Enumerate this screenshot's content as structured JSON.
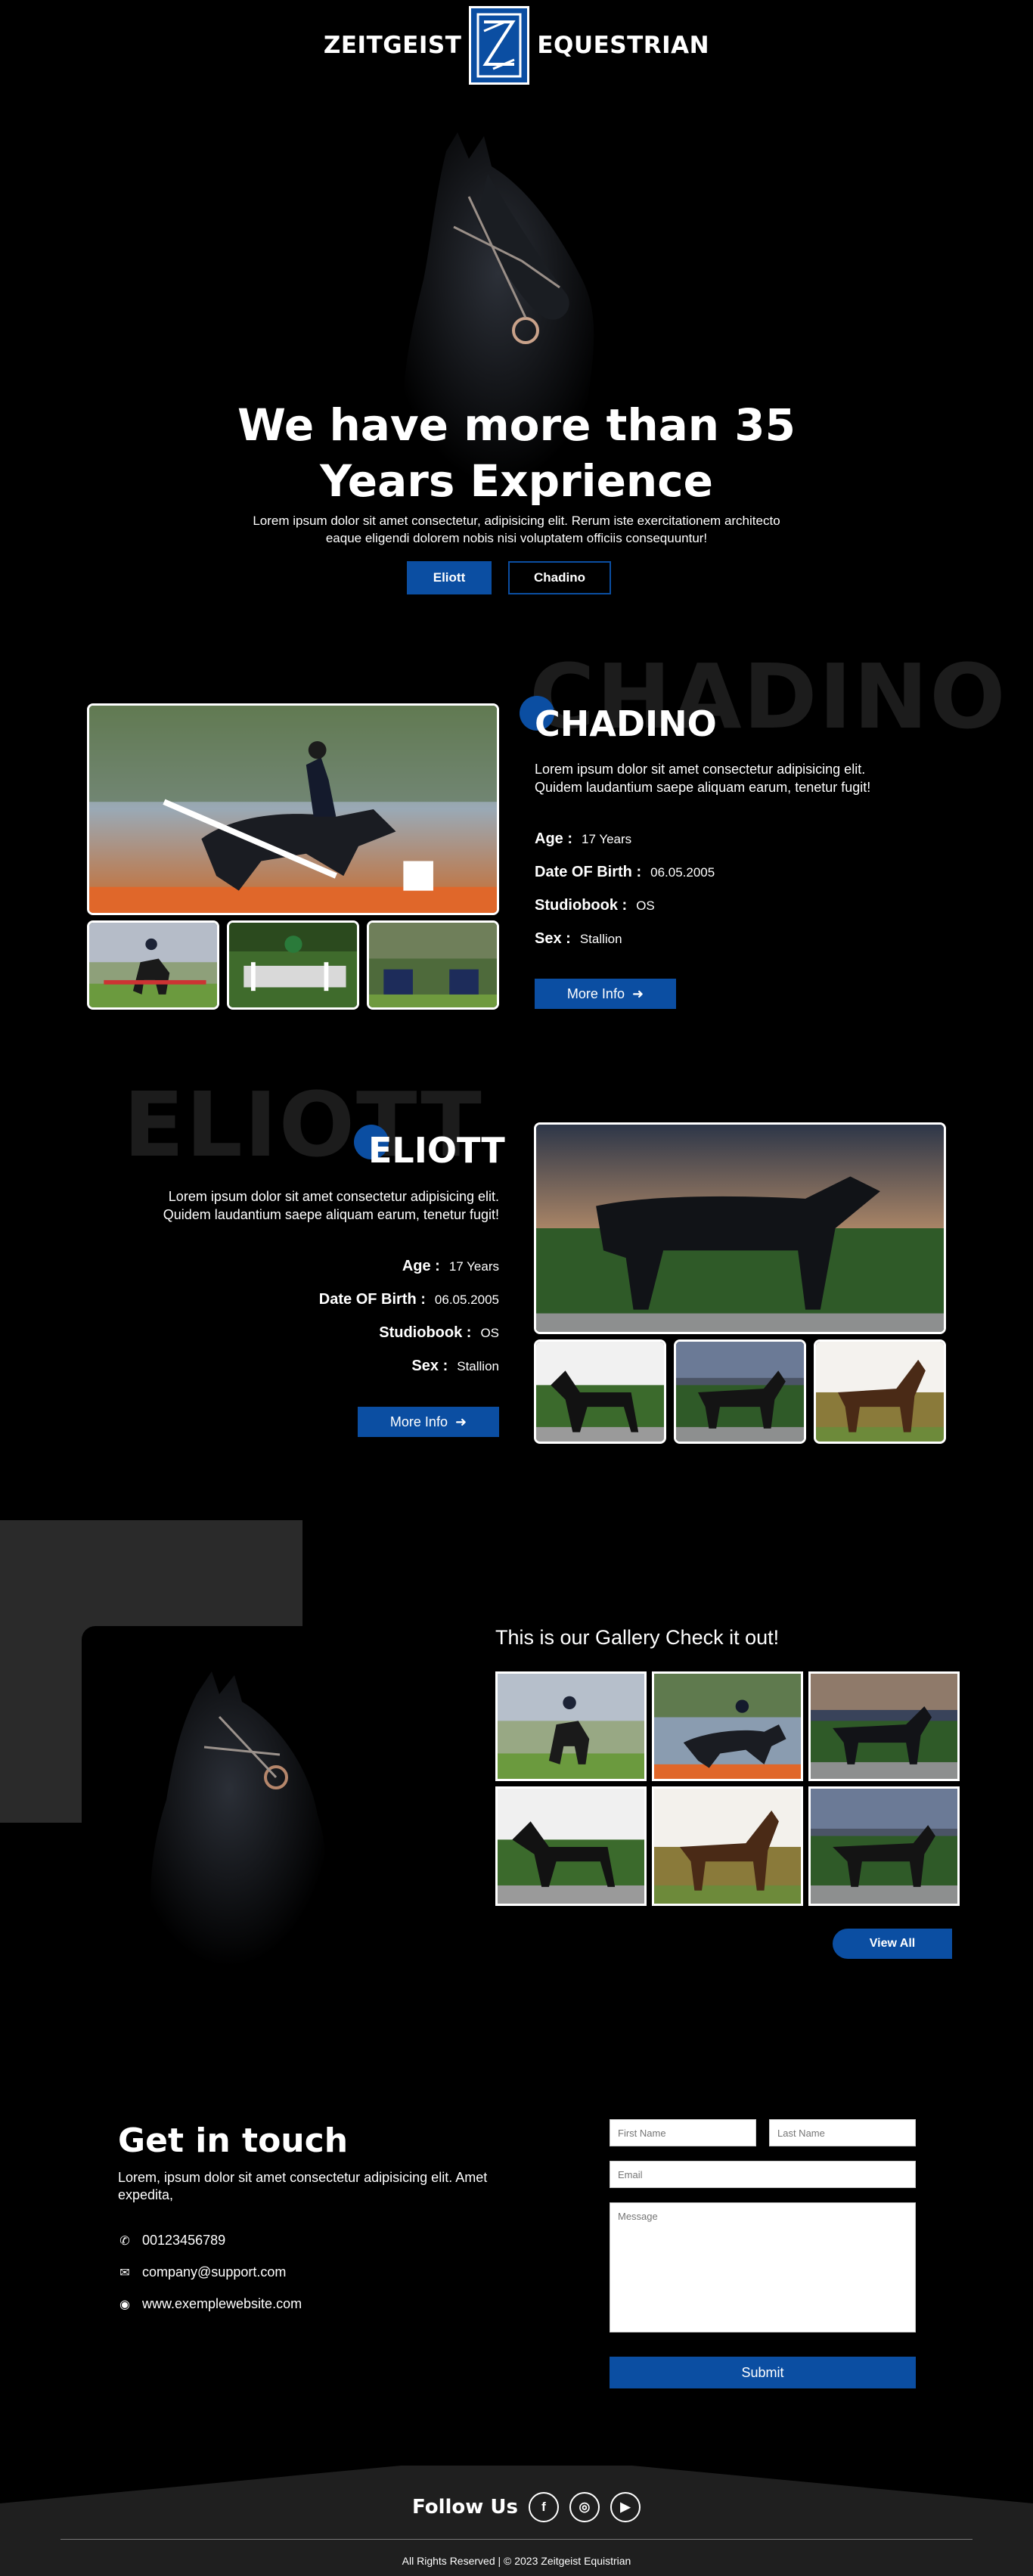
{
  "header": {
    "logo_left": "ZEITGEIST",
    "logo_right": "EQUESTRIAN",
    "logo_icon": "z-monogram-icon"
  },
  "hero": {
    "title_line1": "We have more than 35",
    "title_line2": "Years Exprience",
    "subtitle_line1": "Lorem ipsum dolor sit amet consectetur, adipisicing elit. Rerum iste exercitationem architecto",
    "subtitle_line2": "eaque eligendi dolorem nobis nisi voluptatem officiis consequuntur!",
    "btn_primary": "Eliott",
    "btn_secondary": "Chadino"
  },
  "chadino": {
    "ghost": "CHADINO",
    "name": "CHADINO",
    "desc_line1": "Lorem ipsum dolor sit amet consectetur adipisicing elit.",
    "desc_line2": "Quidem laudantium saepe aliquam earum, tenetur fugit!",
    "stats": [
      {
        "k": "Age :",
        "v": "17 Years"
      },
      {
        "k": "Date OF Birth :",
        "v": "06.05.2005"
      },
      {
        "k": "Studiobook :",
        "v": "OS"
      },
      {
        "k": "Sex :",
        "v": "Stallion"
      }
    ],
    "more": "More Info"
  },
  "eliott": {
    "ghost": "ELIOTT",
    "name": "ELIOTT",
    "desc_line1": "Lorem ipsum dolor sit amet consectetur adipisicing elit.",
    "desc_line2": "Quidem laudantium saepe aliquam earum, tenetur fugit!",
    "stats": [
      {
        "k": "Age :",
        "v": "17 Years"
      },
      {
        "k": "Date OF Birth :",
        "v": "06.05.2005"
      },
      {
        "k": "Studiobook :",
        "v": "OS"
      },
      {
        "k": "Sex :",
        "v": "Stallion"
      }
    ],
    "more": "More Info"
  },
  "gallery": {
    "title": "This is our Gallery Check it out!",
    "view_all": "View All"
  },
  "contact": {
    "title": "Get in touch",
    "desc_line1": "Lorem, ipsum dolor sit amet consectetur adipisicing elit. Amet",
    "desc_line2": "expedita,",
    "phone": "00123456789",
    "email": "company@support.com",
    "website": "www.exemplewebsite.com",
    "form": {
      "first_name": "First Name",
      "last_name": "Last Name",
      "email": "Email",
      "message": "Message",
      "submit": "Submit"
    }
  },
  "footer": {
    "follow": "Follow Us",
    "social": [
      "facebook-icon",
      "instagram-icon",
      "youtube-icon"
    ],
    "copyright": "All Rights Reserved | © 2023 Zeitgeist Equistrian"
  },
  "colors": {
    "accent": "#0b4ea2",
    "background": "#000000",
    "panel": "#2a2a2a"
  }
}
